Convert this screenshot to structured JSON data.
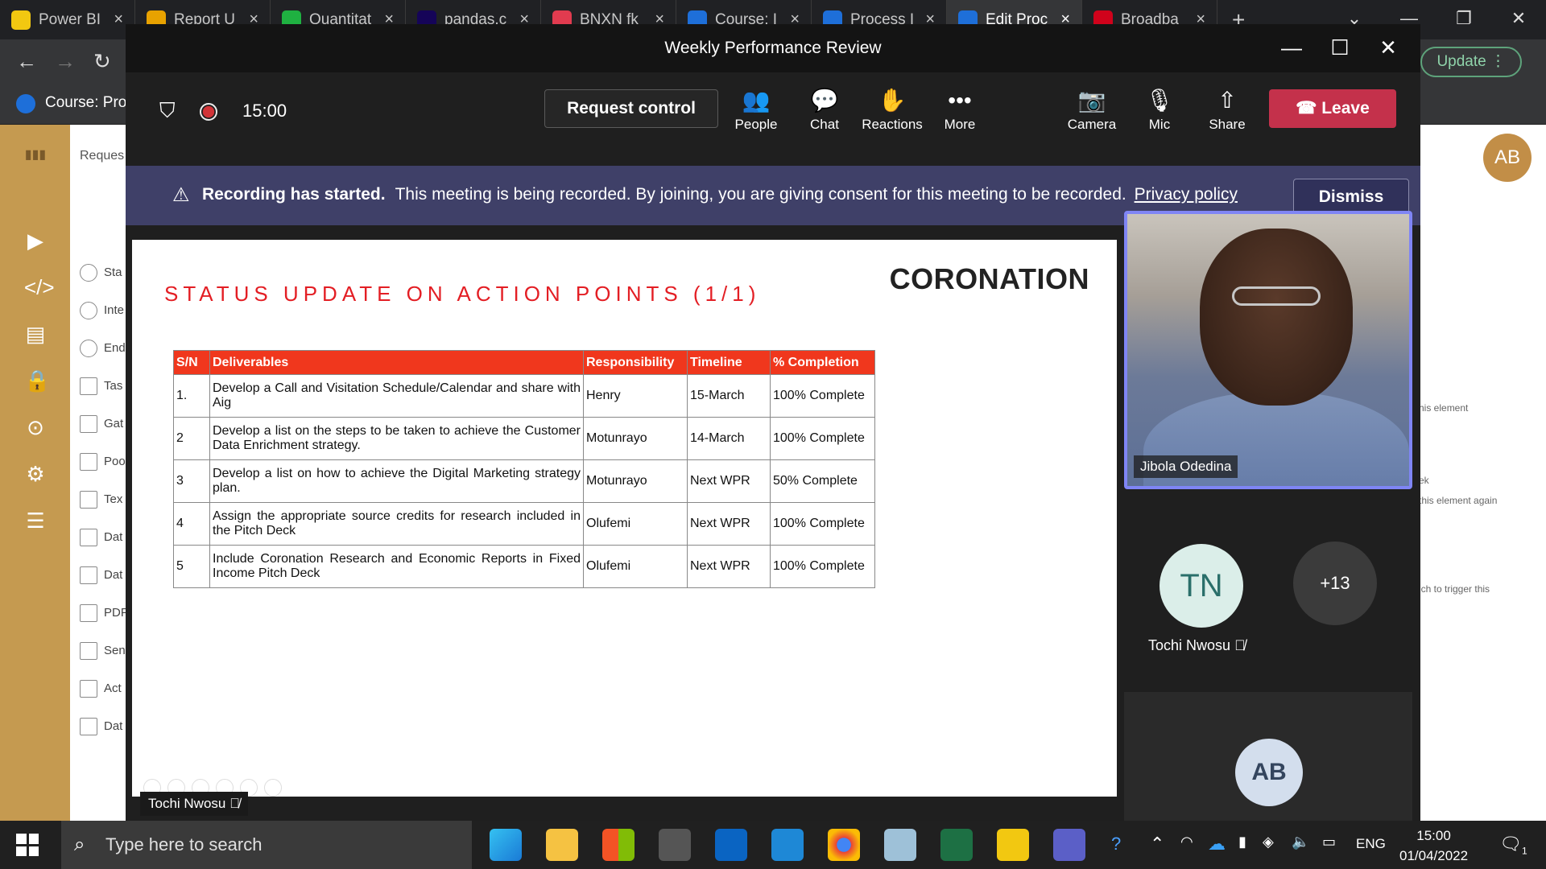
{
  "browser": {
    "tabs": [
      {
        "title": "Power BI",
        "color": "#f2c811",
        "active": false
      },
      {
        "title": "Report U",
        "color": "#e8a200",
        "active": false
      },
      {
        "title": "Quantitat",
        "color": "#1fb141",
        "active": false
      },
      {
        "title": "pandas.c",
        "color": "#150458",
        "active": false
      },
      {
        "title": "BNXN fk",
        "color": "#e13b4f",
        "active": false
      },
      {
        "title": "Course: I",
        "color": "#1e6fd9",
        "active": false
      },
      {
        "title": "Process I",
        "color": "#1e6fd9",
        "active": false
      },
      {
        "title": "Edit Proc",
        "color": "#1e6fd9",
        "active": true
      },
      {
        "title": "Broadba",
        "color": "#d0021b",
        "active": false
      }
    ],
    "new_tab": "+",
    "update_label": "Update",
    "bookmark_label": "Course: Proc"
  },
  "background_app": {
    "breadcrumb_label": "Reques",
    "left_list": [
      "Sta",
      "Inte",
      "End",
      "Tas",
      "Gat",
      "Poo",
      "Tex",
      "Dat",
      "Dat",
      "PDF",
      "Sen",
      "Act",
      "Dat"
    ],
    "right_snippets": [
      "his element",
      "ek",
      "this element again",
      "ich to trigger this"
    ],
    "avatar": "AB"
  },
  "meeting": {
    "window_title": "Weekly Performance Review",
    "timer": "15:00",
    "request_control": "Request control",
    "toolbar": [
      {
        "label": "People",
        "icon": "people-icon",
        "glyph": "👥"
      },
      {
        "label": "Chat",
        "icon": "chat-icon",
        "glyph": "💬"
      },
      {
        "label": "Reactions",
        "icon": "reactions-icon",
        "glyph": "✋"
      },
      {
        "label": "More",
        "icon": "more-icon",
        "glyph": "•••"
      },
      {
        "label": "Camera",
        "icon": "camera-off-icon",
        "glyph": "📷"
      },
      {
        "label": "Mic",
        "icon": "mic-off-icon",
        "glyph": "🎙"
      },
      {
        "label": "Share",
        "icon": "share-icon",
        "glyph": "⇧"
      }
    ],
    "leave_label": "Leave",
    "banner": {
      "bold": "Recording has started.",
      "text": "This meeting is being recorded. By joining, you are giving consent for this meeting to be recorded.",
      "link": "Privacy policy",
      "dismiss": "Dismiss"
    },
    "presenter_label": "Tochi Nwosu",
    "participants": {
      "video_name": "Jibola Odedina",
      "tn_initials": "TN",
      "tn_name": "Tochi Nwosu",
      "overflow": "+13",
      "ab_initials": "AB"
    }
  },
  "slide": {
    "title": "STATUS UPDATE ON ACTION POINTS (1/1)",
    "logo": "CORONATION",
    "headers": [
      "S/N",
      "Deliverables",
      "Responsibility",
      "Timeline",
      "% Completion"
    ],
    "rows": [
      [
        "1.",
        "Develop a Call and Visitation Schedule/Calendar and share with Aig",
        "Henry",
        "15-March",
        "100% Complete"
      ],
      [
        "2",
        "Develop a list on the steps to be taken to achieve the Customer Data Enrichment strategy.",
        "Motunrayo",
        "14-March",
        "100% Complete"
      ],
      [
        "3",
        "Develop a list on how to achieve the Digital Marketing strategy plan.",
        "Motunrayo",
        "Next WPR",
        "50% Complete"
      ],
      [
        "4",
        "Assign the appropriate source credits for research included in the Pitch Deck",
        "Olufemi",
        "Next WPR",
        "100% Complete"
      ],
      [
        "5",
        "Include Coronation Research and Economic Reports in Fixed Income Pitch Deck",
        "Olufemi",
        "Next WPR",
        "100% Complete"
      ]
    ]
  },
  "taskbar": {
    "search_placeholder": "Type here to search",
    "language": "ENG",
    "time": "15:00",
    "date": "01/04/2022",
    "notification_count": "1"
  }
}
